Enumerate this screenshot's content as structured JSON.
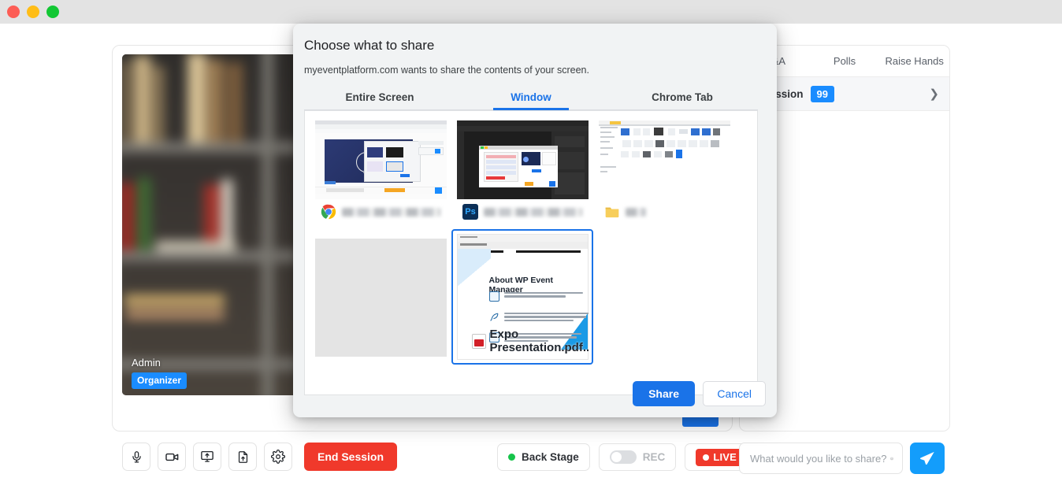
{
  "window": {
    "traffic_lights": [
      "close",
      "minimize",
      "maximize"
    ],
    "colors": {
      "close": "#fd5d55",
      "minimize": "#ffbd16",
      "maximize": "#12c734"
    }
  },
  "stage": {
    "participant_name": "Admin",
    "role_badge": "Organizer"
  },
  "toolbar": {
    "buttons": [
      {
        "name": "microphone-button",
        "icon": "microphone-icon"
      },
      {
        "name": "camera-button",
        "icon": "video-camera-icon"
      },
      {
        "name": "screen-share-button",
        "icon": "screen-share-icon"
      },
      {
        "name": "file-share-button",
        "icon": "file-upload-icon"
      },
      {
        "name": "settings-button",
        "icon": "gear-icon"
      }
    ],
    "end_session_label": "End Session"
  },
  "status": {
    "back_stage_label": "Back Stage",
    "back_stage_dot_color": "#16c44a",
    "rec_label": "REC",
    "rec_enabled": false,
    "live_label": "LIVE",
    "live_color": "#f0392b",
    "viewer_count": "99"
  },
  "sidebar": {
    "tabs": [
      {
        "label": "Q&A",
        "active": false
      },
      {
        "label": "Polls",
        "active": false
      },
      {
        "label": "Raise Hands",
        "active": false
      }
    ],
    "session_row": {
      "label": "In Session",
      "count": "99",
      "count_color": "#1a8cff",
      "chevron": "chevron-right-icon"
    }
  },
  "composer": {
    "placeholder": "What would you like to share?",
    "value": "",
    "emoji_icon": "emoji-smiley-icon",
    "send_icon": "send-paper-plane-icon",
    "send_color": "#139dfb"
  },
  "share_dialog": {
    "title": "Choose what to share",
    "subtitle": "myeventplatform.com wants to share the contents of your screen.",
    "tabs": [
      {
        "label": "Entire Screen",
        "active": false
      },
      {
        "label": "Window",
        "active": true
      },
      {
        "label": "Chrome Tab",
        "active": false
      }
    ],
    "accent_color": "#1a73e8",
    "sources": [
      {
        "name": "chrome-window",
        "icon": "chrome-icon",
        "label_blurred": true,
        "label": "",
        "selected": false,
        "thumb": "chrome"
      },
      {
        "name": "photoshop-window",
        "icon": "photoshop-icon",
        "label_blurred": true,
        "label": "",
        "selected": false,
        "thumb": "photoshop"
      },
      {
        "name": "file-explorer-window",
        "icon": "folder-icon",
        "label_blurred": true,
        "label": "",
        "selected": false,
        "thumb": "explorer"
      },
      {
        "name": "blank-window",
        "icon": "",
        "label_blurred": false,
        "label": "",
        "selected": false,
        "thumb": "blank"
      },
      {
        "name": "pdf-window",
        "icon": "pdf-icon",
        "label_blurred": false,
        "label": "Expo Presentation.pdf...",
        "selected": true,
        "thumb": "pdf"
      }
    ],
    "pdf_preview": {
      "heading": "About WP Event Manager",
      "bullets": [
        "WP Event Manager is the Leading  All in One Event Management Plugin for WordPress .",
        "WP Event Manager is a lightweight, open source, scalable a full featured event management plugin for adding event listing functionality to your WordPress site.",
        "Calendar, ticketing, and powerful WordPress tools to manage your events from frontend as well as backend."
      ]
    },
    "share_label": "Share",
    "cancel_label": "Cancel"
  }
}
